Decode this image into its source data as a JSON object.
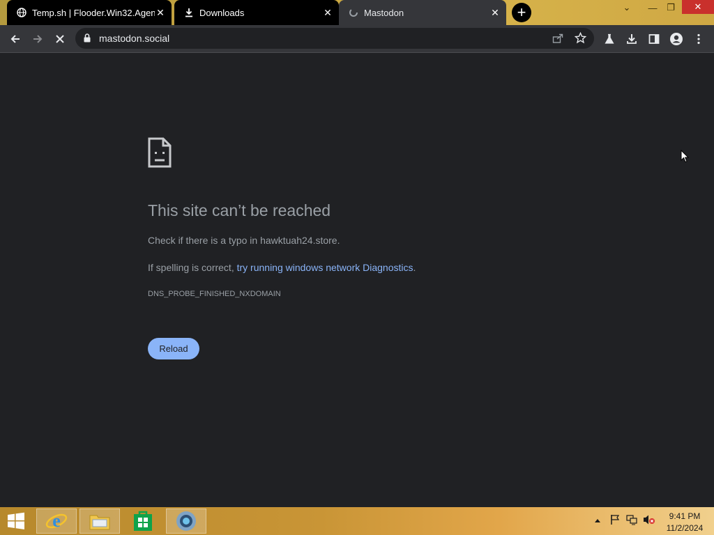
{
  "tabs": [
    {
      "title": "Temp.sh | Flooder.Win32.Agent.",
      "icon": "globe-icon"
    },
    {
      "title": "Downloads",
      "icon": "download-icon"
    },
    {
      "title": "Mastodon",
      "icon": "loading-icon",
      "active": true
    }
  ],
  "toolbar": {
    "url": "mastodon.social"
  },
  "error": {
    "title": "This site can’t be reached",
    "typo_line": "Check if there is a typo in hawktuah24.store.",
    "spelling_prefix": "If spelling is correct, ",
    "spelling_link": "try running windows network Diagnostics",
    "spelling_suffix": ".",
    "code": "DNS_PROBE_FINISHED_NXDOMAIN",
    "reload_label": "Reload"
  },
  "taskbar": {
    "time": "9:41 PM",
    "date": "11/2/2024"
  },
  "colors": {
    "page_bg": "#202124",
    "text": "#9aa0a6",
    "link": "#8ab4f8",
    "toolbar": "#35363a"
  }
}
